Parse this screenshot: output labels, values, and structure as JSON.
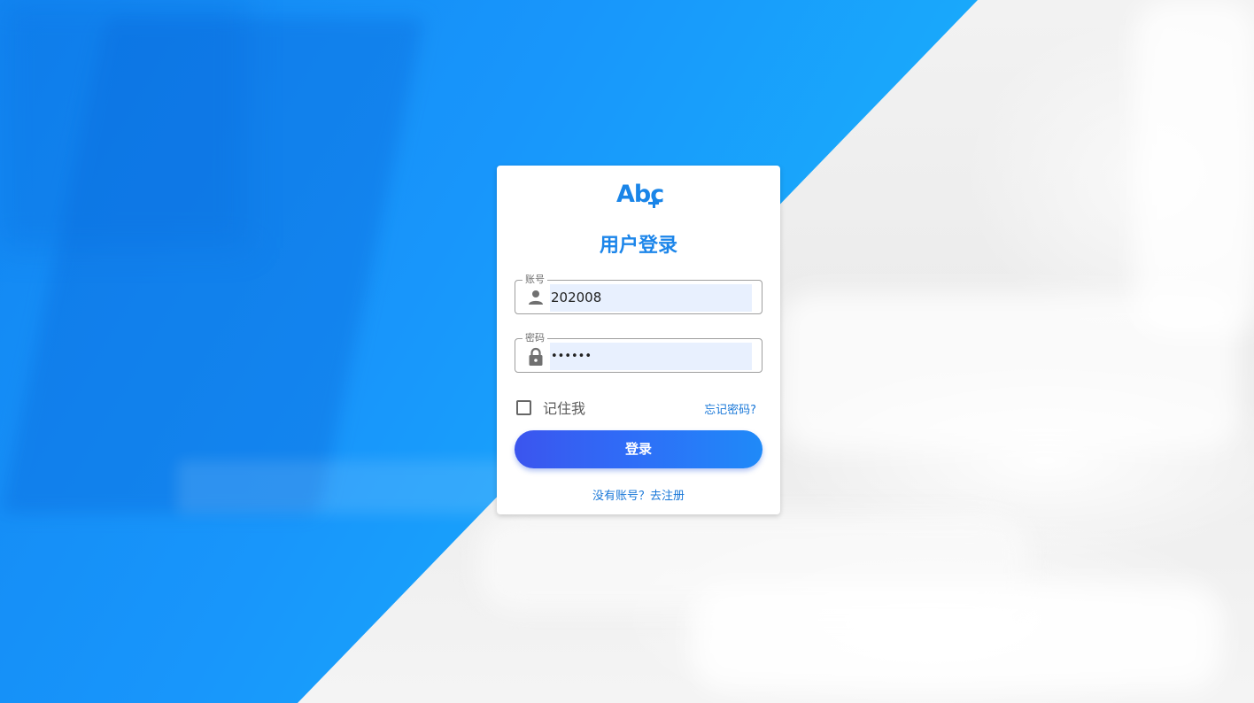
{
  "login": {
    "logo_text": "Abc",
    "title": "用户登录",
    "account": {
      "label": "账号",
      "value": "202008",
      "icon": "person-icon"
    },
    "password": {
      "label": "密码",
      "masked_value": "••••••",
      "icon": "lock-icon"
    },
    "remember_label": "记住我",
    "remember_checked": false,
    "forgot_label": "忘记密码?",
    "submit_label": "登录",
    "register_label": "没有账号？去注册"
  },
  "colors": {
    "accent": "#1d86ea",
    "button_start": "#3b55ee",
    "button_end": "#1f8af8",
    "autofill_bg": "#e8f0fe",
    "link": "#1a78d8"
  }
}
